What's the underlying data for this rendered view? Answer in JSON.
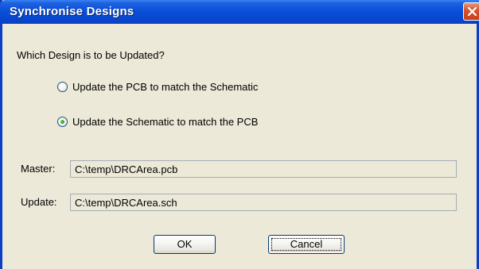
{
  "window": {
    "title": "Synchronise Designs",
    "close_icon": "close-icon"
  },
  "prompt": "Which Design is to be Updated?",
  "options": [
    {
      "label": "Update the PCB to match the Schematic",
      "selected": false
    },
    {
      "label": "Update the Schematic to match the PCB",
      "selected": true
    }
  ],
  "fields": {
    "master_label": "Master:",
    "master_value": "C:\\temp\\DRCArea.pcb",
    "update_label": "Update:",
    "update_value": "C:\\temp\\DRCArea.sch"
  },
  "buttons": {
    "ok_label": "OK",
    "cancel_label": "Cancel"
  },
  "colors": {
    "titlebar": "#0a4fd8",
    "dialog_bg": "#ece9d8",
    "close_button": "#d8542c",
    "radio_selected": "#21a121"
  }
}
